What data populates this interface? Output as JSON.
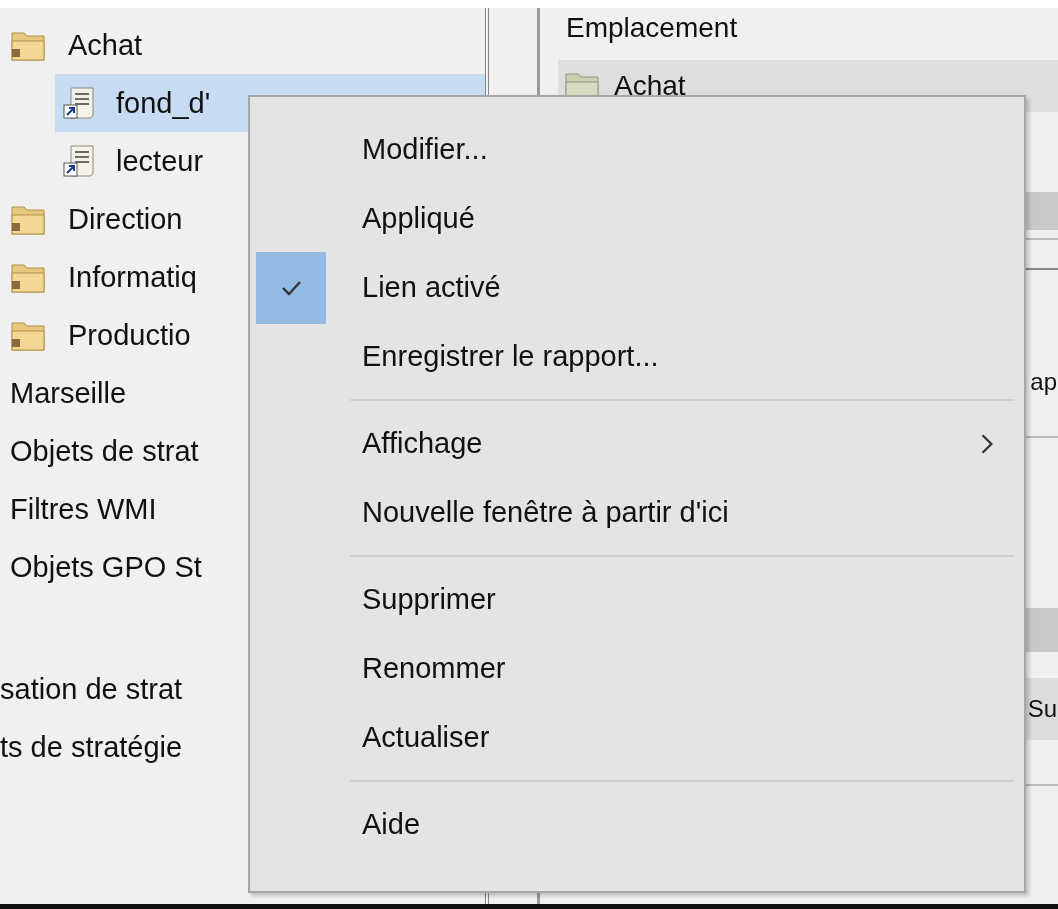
{
  "tree": [
    {
      "label": "Achat",
      "kind": "folder",
      "selected": false,
      "children": [
        {
          "label": "fond_d'",
          "kind": "gpo-link",
          "selected": true
        },
        {
          "label": "lecteur",
          "kind": "gpo-link",
          "selected": false
        }
      ]
    },
    {
      "label": "Direction",
      "kind": "folder",
      "selected": false
    },
    {
      "label": "Informatiq",
      "kind": "folder",
      "selected": false
    },
    {
      "label": "Productio",
      "kind": "folder",
      "selected": false
    }
  ],
  "tree_outer": [
    {
      "label": "Marseille",
      "selected": false
    },
    {
      "label": "Objets de strat",
      "selected": false
    },
    {
      "label": "Filtres WMI",
      "selected": false
    },
    {
      "label": "Objets GPO St",
      "selected": false
    }
  ],
  "tree_lower": [
    {
      "label": "sation de strat",
      "selected": false
    },
    {
      "label": "ts de stratégie",
      "selected": false
    }
  ],
  "details": {
    "column": "Emplacement",
    "rows": [
      {
        "label": "Achat",
        "kind": "folder"
      }
    ],
    "edge_texts": [
      "ap",
      "Su"
    ]
  },
  "context_menu": {
    "groups": [
      [
        {
          "label": "Modifier...",
          "kind": "command",
          "checked": false
        },
        {
          "label": "Appliqué",
          "kind": "command",
          "checked": false
        },
        {
          "label": "Lien activé",
          "kind": "command",
          "checked": true
        },
        {
          "label": "Enregistrer le rapport...",
          "kind": "command",
          "checked": false
        }
      ],
      [
        {
          "label": "Affichage",
          "kind": "submenu",
          "checked": false
        },
        {
          "label": "Nouvelle fenêtre à partir d'ici",
          "kind": "command",
          "checked": false
        }
      ],
      [
        {
          "label": "Supprimer",
          "kind": "command",
          "checked": false
        },
        {
          "label": "Renommer",
          "kind": "command",
          "checked": false
        },
        {
          "label": "Actualiser",
          "kind": "command",
          "checked": false
        }
      ],
      [
        {
          "label": "Aide",
          "kind": "command",
          "checked": false
        }
      ]
    ]
  }
}
